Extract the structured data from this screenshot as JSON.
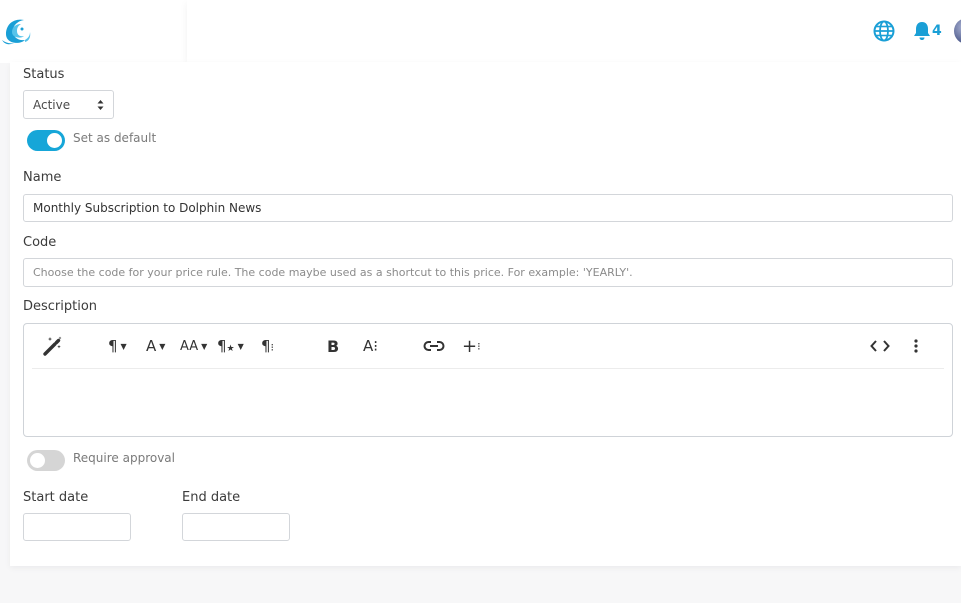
{
  "header": {
    "notification_count": "4",
    "icons": [
      "dolphin-logo-icon",
      "globe-icon",
      "bell-icon"
    ],
    "accent_color": "#16a6d8"
  },
  "form": {
    "status_label": "Status",
    "status_value": "Active",
    "default_toggle": {
      "label": "Set as default",
      "on": true
    },
    "name_label": "Name",
    "name_value": "Monthly Subscription to Dolphin News",
    "code_label": "Code",
    "code_placeholder": "Choose the code for your price rule. The code maybe used as a shortcut to this price. For example: 'YEARLY'.",
    "description_label": "Description",
    "approval_toggle": {
      "label": "Require approval",
      "on": false
    },
    "start_date_label": "Start date",
    "end_date_label": "End date"
  },
  "editor_toolbar": {
    "buttons": [
      "magic-wand",
      "paragraph-format",
      "font-family",
      "font-size",
      "paragraph-style",
      "paragraph-more",
      "bold",
      "text-more",
      "insert-link",
      "insert-more",
      "code-view",
      "more-options"
    ],
    "font_family_glyph": "A",
    "font_size_glyph": "AA",
    "bold_glyph": "B",
    "text_more_glyph": "A⁝"
  }
}
